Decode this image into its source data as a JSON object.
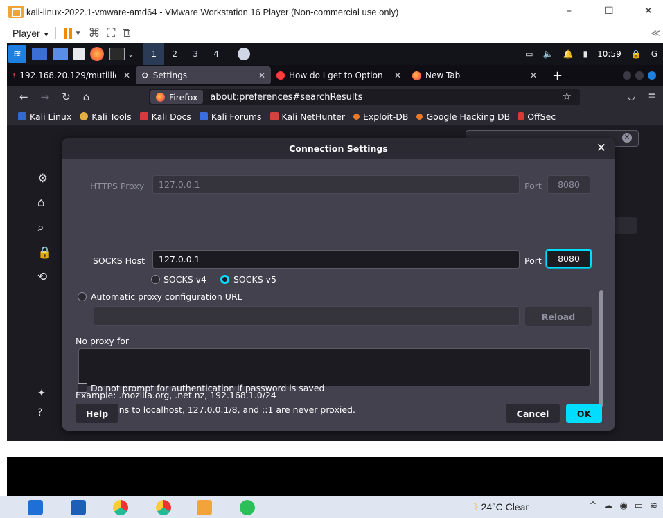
{
  "vmware": {
    "title": "kali-linux-2022.1-vmware-amd64 - VMware Workstation 16 Player (Non-commercial use only)",
    "player_menu": "Player",
    "minimize": "–",
    "maximize": "☐",
    "close": "✕",
    "right_glyph": "≪"
  },
  "kali_panel": {
    "workspaces": [
      "1",
      "2",
      "3",
      "4"
    ],
    "clock": "10:59"
  },
  "firefox": {
    "tabs": [
      {
        "label": "192.168.20.129/mutillid",
        "close": "✕"
      },
      {
        "label": "Settings",
        "close": "✕"
      },
      {
        "label": "How do I get to Option",
        "close": "✕"
      },
      {
        "label": "New Tab",
        "close": "✕"
      }
    ],
    "new_tab": "+",
    "url_identity": "Firefox",
    "url": "about:preferences#searchResults",
    "bookmarks": [
      "Kali Linux",
      "Kali Tools",
      "Kali Docs",
      "Kali Forums",
      "Kali NetHunter",
      "Exploit-DB",
      "Google Hacking DB",
      "OffSec"
    ]
  },
  "dialog": {
    "title": "Connection Settings",
    "close": "✕",
    "https_proxy_label": "HTTPS Proxy",
    "https_proxy_value": "127.0.0.1",
    "https_port_label": "Port",
    "https_port_value": "8080",
    "socks_host_label": "SOCKS Host",
    "socks_host_value": "127.0.0.1",
    "socks_port_label": "Port",
    "socks_port_value": "8080",
    "socks_v4": "SOCKS v4",
    "socks_v5": "SOCKS v5",
    "auto_proxy_label": "Automatic proxy configuration URL",
    "auto_proxy_value": "",
    "reload": "Reload",
    "no_proxy_label": "No proxy for",
    "no_proxy_value": "",
    "example": "Example: .mozilla.org, .net.nz, 192.168.1.0/24",
    "localhost_note": "Connections to localhost, 127.0.0.1/8, and ::1 are never proxied.",
    "no_prompt_auth": "Do not prompt for authentication if password is saved",
    "help": "Help",
    "cancel": "Cancel",
    "ok": "OK"
  },
  "windows_taskbar": {
    "weather": "24°C  Clear",
    "tray_up": "^"
  },
  "colors": {
    "accent": "#00ddff",
    "dialog_bg": "#42414d",
    "page_bg": "#1c1b22",
    "kali_blue": "#1d7fe0",
    "vmware_orange": "#f08a00"
  }
}
